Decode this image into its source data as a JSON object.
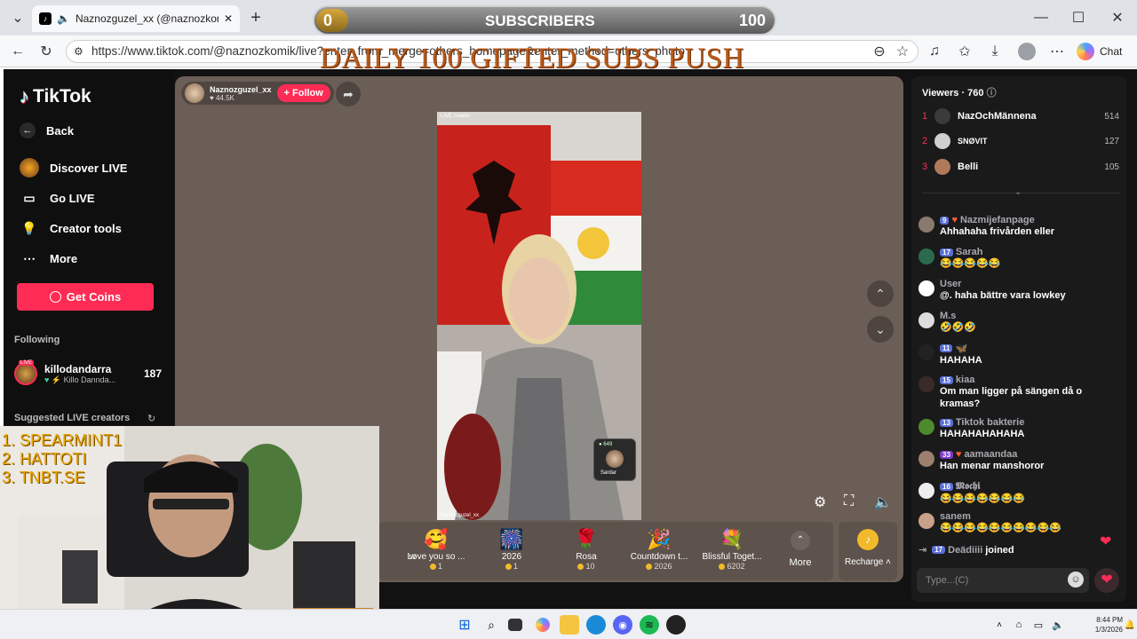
{
  "browser": {
    "tab_title": "Naznozguzel_xx (@naznozkor",
    "url": "https://www.tiktok.com/@naznozkomik/live?enter_from_merge=others_homepage&enter_method=others_photo",
    "chat_label": "Chat"
  },
  "overlay": {
    "sub_count": "0",
    "sub_label": "SUBSCRIBERS",
    "sub_goal": "100",
    "sub_progress": 0,
    "daily_text": "DAILY 100 GIFTED SUBS PUSH"
  },
  "sidebar": {
    "logo": "TikTok",
    "items": [
      {
        "label": "Back",
        "icon": "back-arrow-icon"
      },
      {
        "label": "Discover LIVE",
        "icon": "discover-live-icon"
      },
      {
        "label": "Go LIVE",
        "icon": "camera-icon"
      },
      {
        "label": "Creator tools",
        "icon": "lightbulb-icon"
      },
      {
        "label": "More",
        "icon": "more-icon"
      }
    ],
    "get_coins": "Get Coins",
    "following_title": "Following",
    "following": {
      "name": "killodandarra",
      "sub": "Killo Dannda...",
      "count": "187",
      "badge": "LIVE"
    },
    "suggested_title": "Suggested LIVE creators"
  },
  "stream": {
    "name": "Naznozguzel_xx",
    "likes": "44.5K",
    "follow_label": "+ Follow",
    "video_tag": "LIVE creator",
    "watermark": "Naznozguzel_xx",
    "guest_name": "Sardar",
    "guest_count": "649"
  },
  "gifts": [
    {
      "name": "w",
      "price": "",
      "emoji": ""
    },
    {
      "name": "Love you so ...",
      "price": "1",
      "emoji": "🥰"
    },
    {
      "name": "2026",
      "price": "1",
      "emoji": "🎆"
    },
    {
      "name": "Rosa",
      "price": "10",
      "emoji": "🌹"
    },
    {
      "name": "Countdown t...",
      "price": "2026",
      "emoji": "🎉"
    },
    {
      "name": "Blissful Toget...",
      "price": "6202",
      "emoji": "💐"
    }
  ],
  "gift_more": "More",
  "recharge": "Recharge",
  "chat": {
    "viewers_label": "Viewers",
    "viewers_count": "760",
    "top_viewers": [
      {
        "rank": "1",
        "name": "NazOchMännena",
        "score": "514"
      },
      {
        "rank": "2",
        "name": "SNØVIT",
        "score": "127"
      },
      {
        "rank": "3",
        "name": "Belli",
        "score": "105"
      }
    ],
    "messages": [
      {
        "level": "9",
        "name": "Nazmijefanpage",
        "text": "Ahhahaha frivården eller"
      },
      {
        "level": "17",
        "name": "Sarah",
        "text": "😂😂😂😂😂"
      },
      {
        "level": "",
        "name": "User",
        "text": "@. haha bättre vara lowkey"
      },
      {
        "level": "",
        "name": "M.s",
        "text": "🤣🤣🤣"
      },
      {
        "level": "11",
        "name": "🦋",
        "text": "HAHAHA"
      },
      {
        "level": "15",
        "name": "kiaa",
        "text": "Om man ligger på sängen då o kramas?"
      },
      {
        "level": "13",
        "name": "Tiktok bakterie",
        "text": "HAHAHAHAHAHA"
      },
      {
        "level": "33",
        "name": "aamaandaa",
        "text": "Han menar manshoror"
      },
      {
        "level": "16",
        "name": "𝕸𝖔𝖈𝖍𝖎",
        "text": "😂😂😂😂😂😂😂"
      },
      {
        "level": "",
        "name": "sanem",
        "text": "😂😂😂😂😂😂😂😂😂😂"
      }
    ],
    "joined": {
      "level": "17",
      "name": "Deädiiii",
      "text": "joined"
    },
    "placeholder": "Type...(C)"
  },
  "cam_overlay": {
    "lines": [
      "1.  SPEARMINT1",
      "2.   HATTOTI",
      "3.  TNBT.SE"
    ]
  },
  "taskbar": {
    "time": "8:44 PM",
    "date": "1/3/2026"
  }
}
